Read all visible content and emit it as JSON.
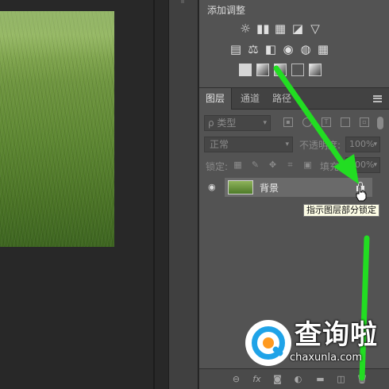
{
  "adjustments": {
    "title": "添加调整",
    "row1": [
      "☼",
      "▮▮",
      "▦",
      "◪",
      "▽"
    ],
    "row2": [
      "▤",
      "⚖",
      "◧",
      "◉",
      "◍",
      "▦"
    ],
    "row3": [
      "◩",
      "◪",
      "◫",
      "☒",
      "▭"
    ]
  },
  "tabs": {
    "layers": "图层",
    "channels": "通道",
    "paths": "路径"
  },
  "filter": {
    "kind_label": "ρ 类型",
    "chevron": "▾"
  },
  "blend": {
    "mode": "正常",
    "opacity_label": "不透明度:",
    "opacity_value": "100%",
    "chevron": "▾"
  },
  "lock": {
    "label": "锁定:",
    "fill_label": "填充:",
    "fill_value": "100%"
  },
  "layer": {
    "name": "背景"
  },
  "tooltip": "指示图层部分锁定",
  "watermark": {
    "brand": "查询啦",
    "url": "chaxunla.com"
  },
  "colors": {
    "annotation_arrow": "#22dd22",
    "panel_bg": "#535353"
  }
}
